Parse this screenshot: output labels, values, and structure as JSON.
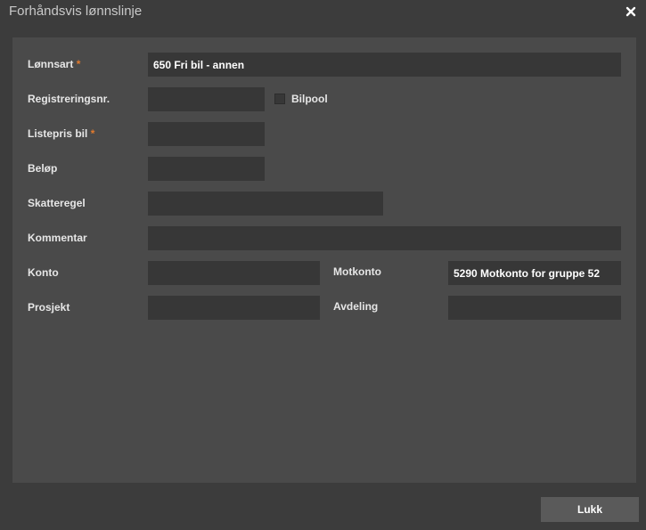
{
  "dialog": {
    "title": "Forhåndsvis lønnslinje",
    "close_icon": "close-icon",
    "close_button_label": "Lukk"
  },
  "form": {
    "required_marker": "*",
    "lonnsart": {
      "label": "Lønnsart",
      "value": "650 Fri bil - annen"
    },
    "registreringsnr": {
      "label": "Registreringsnr.",
      "value": ""
    },
    "bilpool": {
      "label": "Bilpool",
      "checked": false
    },
    "listepris": {
      "label": "Listepris bil",
      "value": ""
    },
    "belop": {
      "label": "Beløp",
      "value": ""
    },
    "skatteregel": {
      "label": "Skatteregel",
      "value": ""
    },
    "kommentar": {
      "label": "Kommentar",
      "value": ""
    },
    "konto": {
      "label": "Konto",
      "value": ""
    },
    "motkonto": {
      "label": "Motkonto",
      "value": "5290 Motkonto for gruppe 52"
    },
    "prosjekt": {
      "label": "Prosjekt",
      "value": ""
    },
    "avdeling": {
      "label": "Avdeling",
      "value": ""
    }
  },
  "colors": {
    "background": "#3c3c3c",
    "panel": "#4a4a4a",
    "field": "#373737",
    "required": "#e07a2e",
    "button": "#5a5a5a"
  }
}
